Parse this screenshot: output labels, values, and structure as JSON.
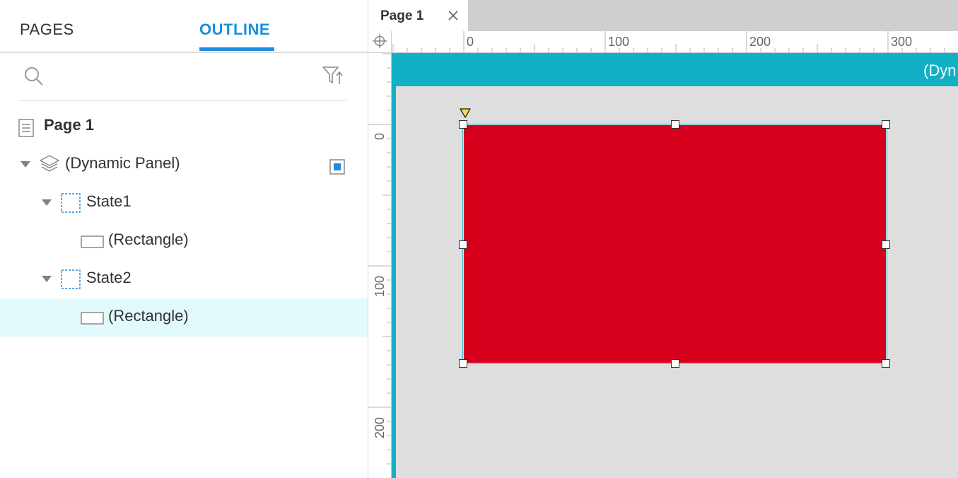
{
  "left_panel": {
    "tabs": {
      "pages": "PAGES",
      "outline": "OUTLINE"
    },
    "search": {
      "icon": "magnifier",
      "filter_icon": "filter-sort"
    },
    "tree": {
      "page": {
        "label": "Page 1",
        "icon": "page-icon"
      },
      "dynamic_panel": {
        "label": "(Dynamic Panel)",
        "icon": "layers-icon"
      },
      "state1": {
        "label": "State1",
        "icon": "state-icon",
        "child": {
          "label": "(Rectangle)",
          "icon": "rectangle-icon"
        }
      },
      "state2": {
        "label": "State2",
        "icon": "state-icon",
        "child": {
          "label": "(Rectangle)",
          "icon": "rectangle-icon",
          "selected": true
        }
      }
    }
  },
  "canvas": {
    "tab": {
      "label": "Page 1",
      "close": "×"
    },
    "ruler_h_labels": [
      "0",
      "100",
      "200",
      "300"
    ],
    "ruler_v_labels": [
      "0",
      "100",
      "200"
    ],
    "panel_header_label": "(Dyn",
    "colors": {
      "accent": "#1a8fdc",
      "panel": "#11b0c4",
      "rectangle": "#d6001c",
      "selection_row": "#e2fafb",
      "canvas_bg": "#dedede"
    }
  }
}
